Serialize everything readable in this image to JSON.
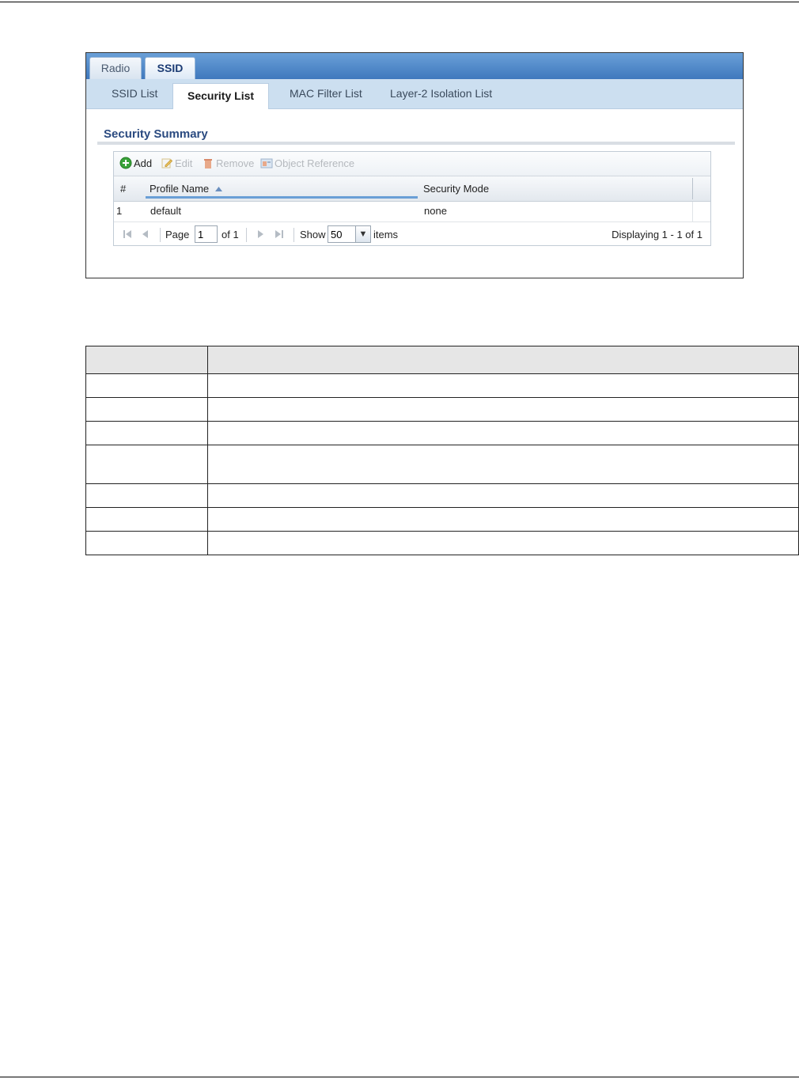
{
  "tabs": {
    "radio": "Radio",
    "ssid": "SSID"
  },
  "subtabs": [
    "SSID List",
    "Security List",
    "MAC Filter List",
    "Layer-2 Isolation List"
  ],
  "section_title": "Security Summary",
  "toolbar": {
    "add": "Add",
    "edit": "Edit",
    "remove": "Remove",
    "object_reference": "Object Reference"
  },
  "columns": {
    "index": "#",
    "profile_name": "Profile Name",
    "security_mode": "Security Mode"
  },
  "rows": [
    {
      "index": "1",
      "profile_name": "default",
      "security_mode": "none"
    }
  ],
  "pager": {
    "page_label": "Page",
    "page_value": "1",
    "of_label": "of 1",
    "show_label": "Show",
    "show_value": "50",
    "items_label": "items",
    "displaying": "Displaying 1 - 1 of 1"
  },
  "colors": {
    "tab_bar": "#3f78bd",
    "subtab_bar": "#ccdff0",
    "title": "#2a4a80",
    "add_icon": "#3aa33a"
  }
}
